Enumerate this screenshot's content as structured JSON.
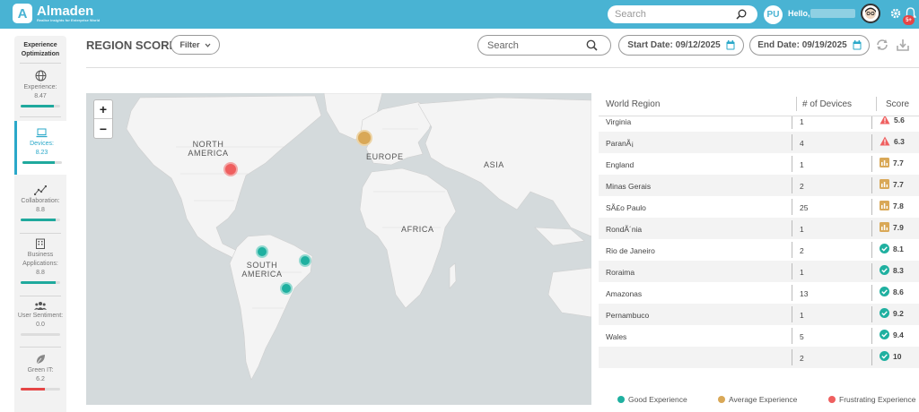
{
  "app": {
    "name": "Almaden",
    "tagline": "Realise insights for Enterprise World",
    "logo_letter": "A"
  },
  "topbar": {
    "search_placeholder": "Search",
    "avatar_initials": "PU",
    "greeting": "Hello,",
    "notification_badge": "5+"
  },
  "sidebar": {
    "title": "Experience Optimization",
    "items": [
      {
        "label": "Experience:",
        "value": "8.47",
        "fill": 0.85,
        "icon": "globe-icon"
      },
      {
        "label": "Devices:",
        "value": "8.23",
        "fill": 0.82,
        "icon": "laptop-icon",
        "active": true
      },
      {
        "label": "Collaboration:",
        "value": "8.8",
        "fill": 0.88,
        "icon": "network-icon"
      },
      {
        "label": "Business Applications:",
        "value": "8.8",
        "fill": 0.88,
        "icon": "building-icon"
      },
      {
        "label": "User Sentiment:",
        "value": "0.0",
        "fill": 0.0,
        "icon": "users-icon"
      },
      {
        "label": "Green IT:",
        "value": "6.2",
        "fill": 0.62,
        "icon": "leaf-icon"
      }
    ]
  },
  "header": {
    "title": "REGION SCORE",
    "filter_label": "Filter",
    "search_placeholder": "Search",
    "start_label": "Start Date:",
    "start_value": "09/12/2025",
    "end_label": "End Date:",
    "end_value": "09/19/2025"
  },
  "map": {
    "zoom_in": "+",
    "zoom_out": "−",
    "labels": [
      "NORTH AMERICA",
      "EUROPE",
      "ASIA",
      "AFRICA",
      "SOUTH AMERICA"
    ]
  },
  "table": {
    "headers": [
      "World Region",
      "# of Devices",
      "Score"
    ],
    "rows": [
      {
        "region": "Virginia",
        "devices": "1",
        "score": "5.6",
        "status": "frustrating"
      },
      {
        "region": "ParanÃ¡",
        "devices": "4",
        "score": "6.3",
        "status": "frustrating"
      },
      {
        "region": "England",
        "devices": "1",
        "score": "7.7",
        "status": "average"
      },
      {
        "region": "Minas Gerais",
        "devices": "2",
        "score": "7.7",
        "status": "average"
      },
      {
        "region": "SÃ£o Paulo",
        "devices": "25",
        "score": "7.8",
        "status": "average"
      },
      {
        "region": "RondÃ´nia",
        "devices": "1",
        "score": "7.9",
        "status": "average"
      },
      {
        "region": "Rio de Janeiro",
        "devices": "2",
        "score": "8.1",
        "status": "good"
      },
      {
        "region": "Roraima",
        "devices": "1",
        "score": "8.3",
        "status": "good"
      },
      {
        "region": "Amazonas",
        "devices": "13",
        "score": "8.6",
        "status": "good"
      },
      {
        "region": "Pernambuco",
        "devices": "1",
        "score": "9.2",
        "status": "good"
      },
      {
        "region": "Wales",
        "devices": "5",
        "score": "9.4",
        "status": "good"
      },
      {
        "region": "",
        "devices": "2",
        "score": "10",
        "status": "good"
      }
    ]
  },
  "legend": [
    {
      "label": "Good Experience",
      "color": "#1fb0a0"
    },
    {
      "label": "Average Experience",
      "color": "#d9a857"
    },
    {
      "label": "Frustrating Experience",
      "color": "#ef5f5f"
    }
  ],
  "colors": {
    "topbar": "#49b3d3",
    "good": "#1fb0a0",
    "average": "#d9a857",
    "frustrating": "#ef5f5f"
  }
}
